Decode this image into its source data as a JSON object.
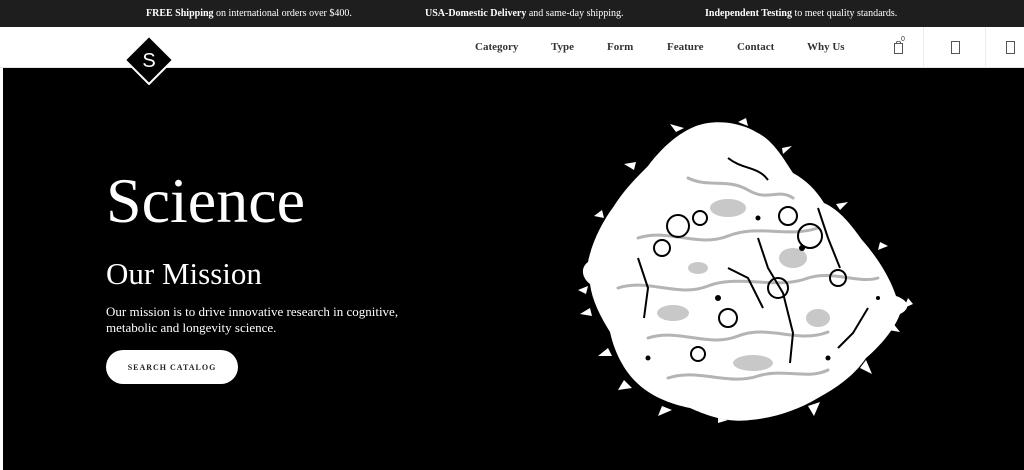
{
  "announcement": {
    "items": [
      {
        "bold": "FREE Shipping",
        "rest": " on international orders over $400."
      },
      {
        "bold": "USA-Domestic Delivery",
        "rest": " and same-day shipping."
      },
      {
        "bold": "Independent Testing",
        "rest": " to meet quality standards."
      }
    ]
  },
  "header": {
    "logo_letter": "S",
    "nav": [
      "Category",
      "Type",
      "Form",
      "Feature",
      "Contact",
      "Why Us"
    ],
    "cart_count": "0",
    "icons": {
      "cart": "cart-icon",
      "account": "user-icon",
      "search": "search-icon"
    }
  },
  "hero": {
    "title": "Science",
    "subtitle": "Our Mission",
    "description": "Our mission is to drive innovative research in cognitive, metabolic and longevity science.",
    "button_label": "SEARCH CATALOG",
    "image": "marbled-cell-artwork"
  },
  "colors": {
    "announcement_bg": "#1e1e1e",
    "hero_bg": "#000000",
    "button_bg": "#ffffff",
    "text_dark": "#333333"
  }
}
